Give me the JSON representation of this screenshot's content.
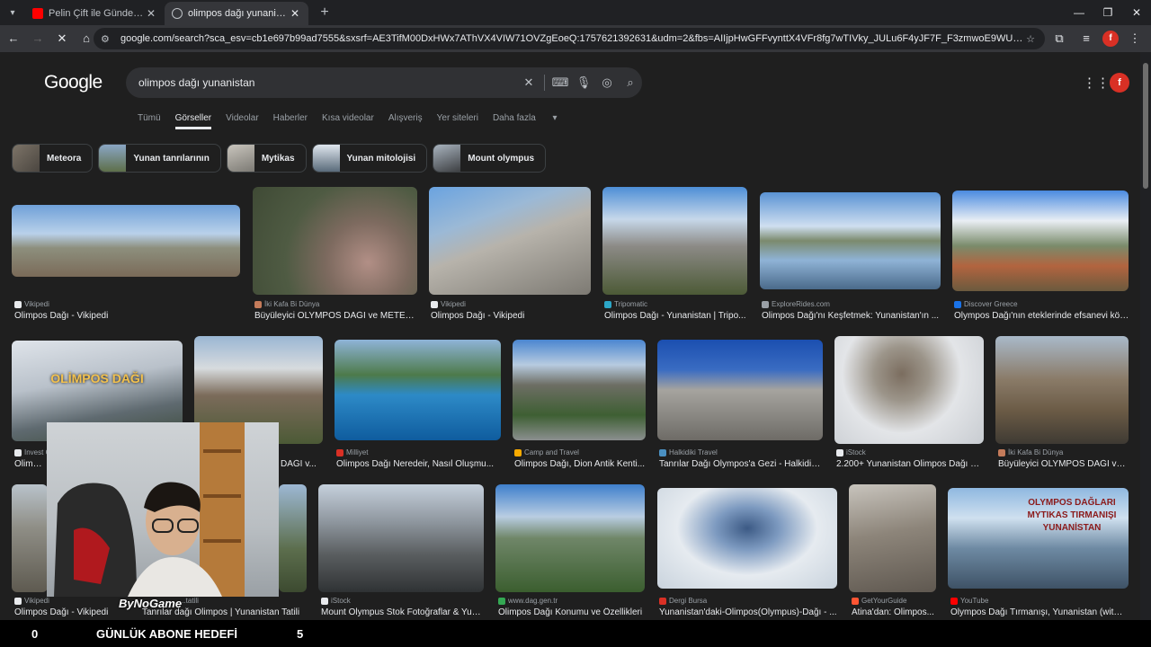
{
  "browser": {
    "tabs": [
      {
        "title": "Pelin Çift ile Gündem Ötesi 473. ..."
      },
      {
        "title": "olimpos dağı yunanistan - Google"
      }
    ],
    "url": "google.com/search?sca_esv=cb1e697b99ad7555&sxsrf=AE3TifM00DxHWx7AThVX4VIW71OVZgEoeQ:1757621392631&udm=2&fbs=AIIjpHwGFFvynttX4VFr8fg7wTIVky_JULu6F4yJF7F_F3zmwoE9WUnKOo8gvFEq5mrnL6o4XSKviBin33dp3gMSEg..."
  },
  "google": {
    "logo": "Google",
    "query": "olimpos dağı yunanistan",
    "tabs": [
      "Tümü",
      "Görseller",
      "Videolar",
      "Haberler",
      "Kısa videolar",
      "Alışveriş",
      "Yer siteleri",
      "Daha fazla"
    ],
    "chips": [
      "Meteora",
      "Yunan tanrılarının",
      "Mytikas",
      "Yunan mitolojisi",
      "Mount olympus"
    ]
  },
  "results": [
    {
      "source": "Vikipedi",
      "caption": "Olimpos Dağı - Vikipedi"
    },
    {
      "source": "İki Kafa Bi Dünya",
      "caption": "Büyüleyici OLYMPOS DAĞI ve METEO..."
    },
    {
      "source": "Vikipedi",
      "caption": "Olimpos Dağı - Vikipedi"
    },
    {
      "source": "Tripomatic",
      "caption": "Olimpos Dağı - Yunanistan | Tripo..."
    },
    {
      "source": "ExploreRides.com",
      "caption": "Olimpos Dağı'nı Keşfetmek: Yunanistan'ın ..."
    },
    {
      "source": "Discover Greece",
      "caption": "Olympos Dağı'nın eteklerinde efsanevi köy..."
    },
    {
      "source": "Invest G...",
      "caption": "Olimpos...",
      "overlay": "OLİMPOS DAĞI"
    },
    {
      "source": "",
      "caption": "DAĞI v..."
    },
    {
      "source": "Milliyet",
      "caption": "Olimpos Dağı Neredeir, Nasıl Oluşmu..."
    },
    {
      "source": "Camp and Travel",
      "caption": "Olimpos Dağı, Dion Antik Kenti..."
    },
    {
      "source": "Halkidiki Travel",
      "caption": "Tanrılar Dağı Olympos'a Gezi - Halkidik..."
    },
    {
      "source": "iStock",
      "caption": "2.200+ Yunanistan Olimpos Dağı S..."
    },
    {
      "source": "İki Kafa Bi Dünya",
      "caption": "Büyüleyici OLYMPOS DAĞI ve..."
    },
    {
      "source": "Vikipedi",
      "caption": "Olimpos Dağı - Vikipedi"
    },
    {
      "source": "...tatili",
      "caption": "Tanrılar dağı Olimpos | Yunanistan Tatili"
    },
    {
      "source": "iStock",
      "caption": "Mount Olympus Stok Fotoğraflar & Yun..."
    },
    {
      "source": "www.dag.gen.tr",
      "caption": "Olimpos Dağı Konumu ve Özellikleri"
    },
    {
      "source": "Dergi Bursa",
      "caption": "Yunanistan'daki-Olimpos(Olympus)-Dağı - ..."
    },
    {
      "source": "GetYourGuide",
      "caption": "Atina'dan: Olimpos..."
    },
    {
      "source": "YouTube",
      "caption": "Olympos Dağı Tırmanışı, Yunanistan (with ...",
      "overlay": "OLYMPOS DAĞLARI MYTIKAS TIRMANIŞI YUNANİSTAN"
    }
  ],
  "stream": {
    "left_count": "0",
    "goal_label": "GÜNLÜK ABONE HEDEFİ",
    "right_count": "5",
    "watermark": "ByNoGame"
  },
  "colors": {
    "page_bg": "#1f1f1f",
    "search_bg": "#303134",
    "accent_red": "#d93025"
  }
}
